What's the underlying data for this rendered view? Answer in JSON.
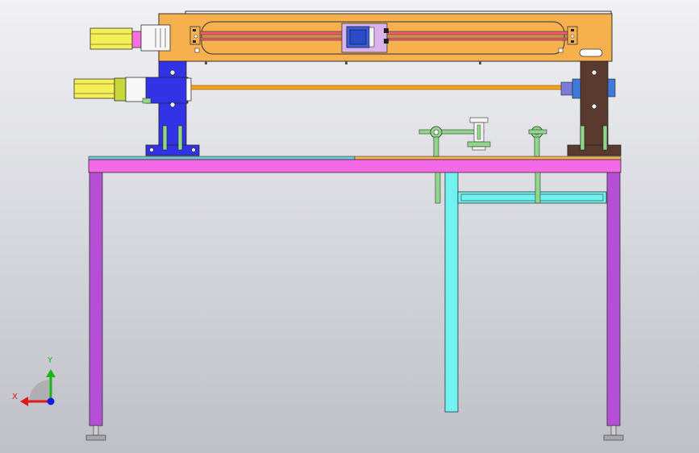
{
  "app": {
    "view": "CAD front view"
  },
  "colors": {
    "frame": "#f6b04d",
    "rail": "#ef5a6f",
    "carriage": "#3a5fe0",
    "left_column": "#3232e6",
    "right_column": "#5a3a2e",
    "motor": "#f4ef55",
    "coupler": "#f46ee0",
    "table_top": "#f268e6",
    "legs": "#b54fd6",
    "center_post": "#6ff2f0",
    "green_parts": "#8fd88a",
    "lead_screw": "#f5a020"
  },
  "triad": {
    "x_label": "X",
    "y_label": "Y",
    "x_color": "#e01818",
    "y_color": "#18b418",
    "z_color": "#1818e0"
  },
  "icons": [
    "motor-icon",
    "carriage-icon",
    "triad-icon"
  ]
}
